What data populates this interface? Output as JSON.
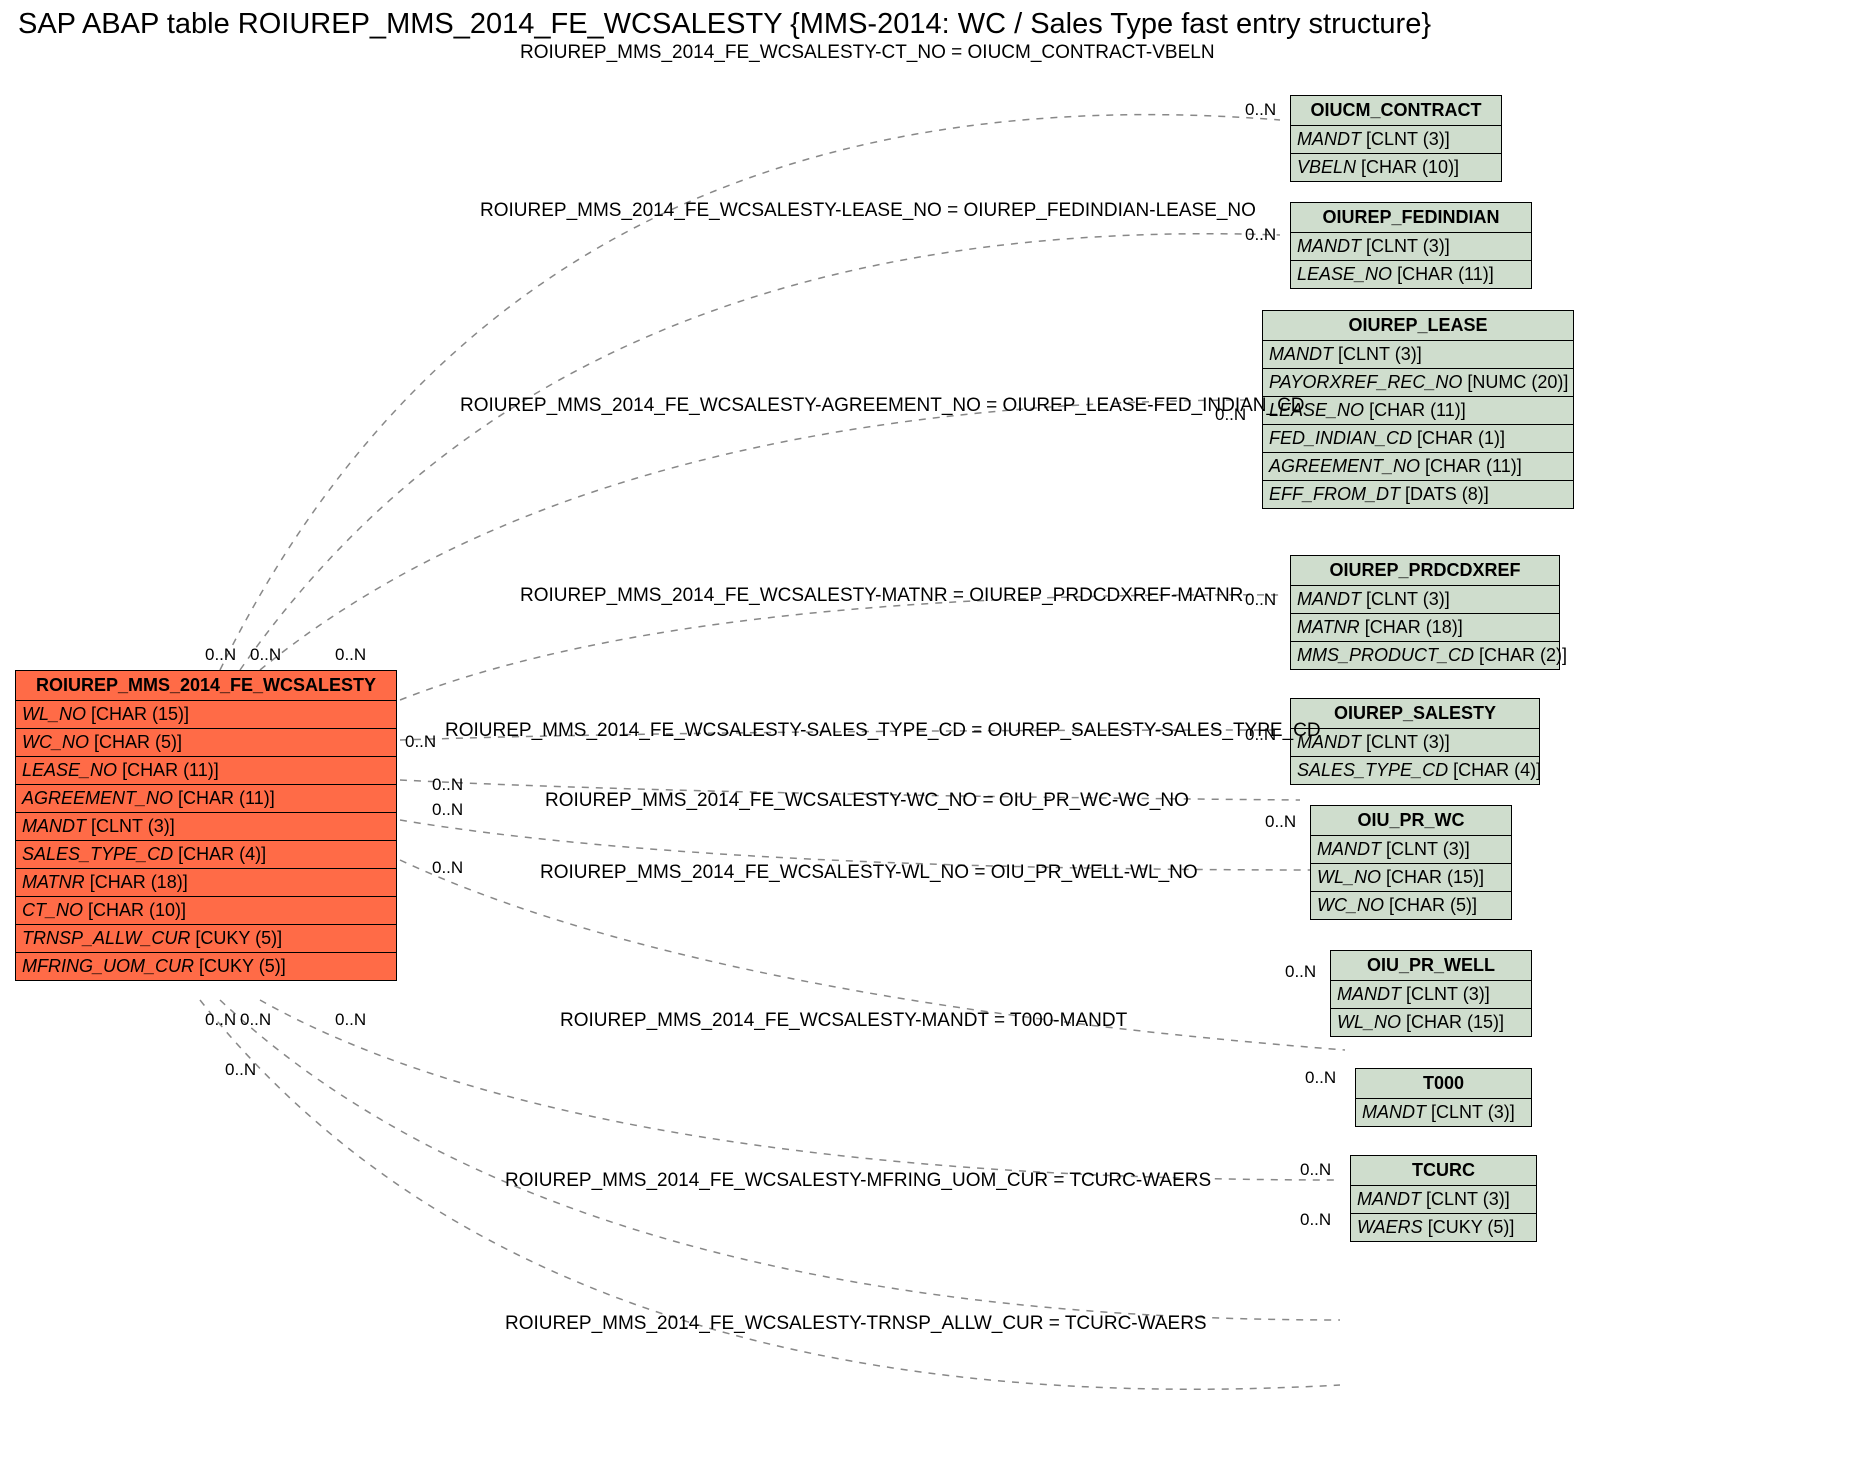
{
  "title": "SAP ABAP table ROIUREP_MMS_2014_FE_WCSALESTY {MMS-2014:  WC / Sales Type fast entry structure}",
  "main": {
    "name": "ROIUREP_MMS_2014_FE_WCSALESTY",
    "fields": [
      {
        "name": "WL_NO",
        "type": "[CHAR (15)]"
      },
      {
        "name": "WC_NO",
        "type": "[CHAR (5)]"
      },
      {
        "name": "LEASE_NO",
        "type": "[CHAR (11)]"
      },
      {
        "name": "AGREEMENT_NO",
        "type": "[CHAR (11)]"
      },
      {
        "name": "MANDT",
        "type": "[CLNT (3)]"
      },
      {
        "name": "SALES_TYPE_CD",
        "type": "[CHAR (4)]"
      },
      {
        "name": "MATNR",
        "type": "[CHAR (18)]"
      },
      {
        "name": "CT_NO",
        "type": "[CHAR (10)]"
      },
      {
        "name": "TRNSP_ALLW_CUR",
        "type": "[CUKY (5)]"
      },
      {
        "name": "MFRING_UOM_CUR",
        "type": "[CUKY (5)]"
      }
    ]
  },
  "targets": [
    {
      "name": "OIUCM_CONTRACT",
      "fields": [
        {
          "name": "MANDT",
          "type": "[CLNT (3)]"
        },
        {
          "name": "VBELN",
          "type": "[CHAR (10)]"
        }
      ]
    },
    {
      "name": "OIUREP_FEDINDIAN",
      "fields": [
        {
          "name": "MANDT",
          "type": "[CLNT (3)]"
        },
        {
          "name": "LEASE_NO",
          "type": "[CHAR (11)]"
        }
      ]
    },
    {
      "name": "OIUREP_LEASE",
      "fields": [
        {
          "name": "MANDT",
          "type": "[CLNT (3)]"
        },
        {
          "name": "PAYORXREF_REC_NO",
          "type": "[NUMC (20)]"
        },
        {
          "name": "LEASE_NO",
          "type": "[CHAR (11)]"
        },
        {
          "name": "FED_INDIAN_CD",
          "type": "[CHAR (1)]"
        },
        {
          "name": "AGREEMENT_NO",
          "type": "[CHAR (11)]"
        },
        {
          "name": "EFF_FROM_DT",
          "type": "[DATS (8)]"
        }
      ]
    },
    {
      "name": "OIUREP_PRDCDXREF",
      "fields": [
        {
          "name": "MANDT",
          "type": "[CLNT (3)]"
        },
        {
          "name": "MATNR",
          "type": "[CHAR (18)]"
        },
        {
          "name": "MMS_PRODUCT_CD",
          "type": "[CHAR (2)]"
        }
      ]
    },
    {
      "name": "OIUREP_SALESTY",
      "fields": [
        {
          "name": "MANDT",
          "type": "[CLNT (3)]"
        },
        {
          "name": "SALES_TYPE_CD",
          "type": "[CHAR (4)]"
        }
      ]
    },
    {
      "name": "OIU_PR_WC",
      "fields": [
        {
          "name": "MANDT",
          "type": "[CLNT (3)]"
        },
        {
          "name": "WL_NO",
          "type": "[CHAR (15)]"
        },
        {
          "name": "WC_NO",
          "type": "[CHAR (5)]"
        }
      ]
    },
    {
      "name": "OIU_PR_WELL",
      "fields": [
        {
          "name": "MANDT",
          "type": "[CLNT (3)]"
        },
        {
          "name": "WL_NO",
          "type": "[CHAR (15)]"
        }
      ]
    },
    {
      "name": "T000",
      "fields": [
        {
          "name": "MANDT",
          "type": "[CLNT (3)]"
        }
      ]
    },
    {
      "name": "TCURC",
      "fields": [
        {
          "name": "MANDT",
          "type": "[CLNT (3)]"
        },
        {
          "name": "WAERS",
          "type": "[CUKY (5)]"
        }
      ]
    }
  ],
  "rels": [
    {
      "text": "ROIUREP_MMS_2014_FE_WCSALESTY-CT_NO = OIUCM_CONTRACT-VBELN"
    },
    {
      "text": "ROIUREP_MMS_2014_FE_WCSALESTY-LEASE_NO = OIUREP_FEDINDIAN-LEASE_NO"
    },
    {
      "text": "ROIUREP_MMS_2014_FE_WCSALESTY-AGREEMENT_NO = OIUREP_LEASE-FED_INDIAN_CD"
    },
    {
      "text": "ROIUREP_MMS_2014_FE_WCSALESTY-MATNR = OIUREP_PRDCDXREF-MATNR"
    },
    {
      "text": "ROIUREP_MMS_2014_FE_WCSALESTY-SALES_TYPE_CD = OIUREP_SALESTY-SALES_TYPE_CD"
    },
    {
      "text": "ROIUREP_MMS_2014_FE_WCSALESTY-WC_NO = OIU_PR_WC-WC_NO"
    },
    {
      "text": "ROIUREP_MMS_2014_FE_WCSALESTY-WL_NO = OIU_PR_WELL-WL_NO"
    },
    {
      "text": "ROIUREP_MMS_2014_FE_WCSALESTY-MANDT = T000-MANDT"
    },
    {
      "text": "ROIUREP_MMS_2014_FE_WCSALESTY-MFRING_UOM_CUR = TCURC-WAERS"
    },
    {
      "text": "ROIUREP_MMS_2014_FE_WCSALESTY-TRNSP_ALLW_CUR = TCURC-WAERS"
    }
  ],
  "card": "0..N"
}
